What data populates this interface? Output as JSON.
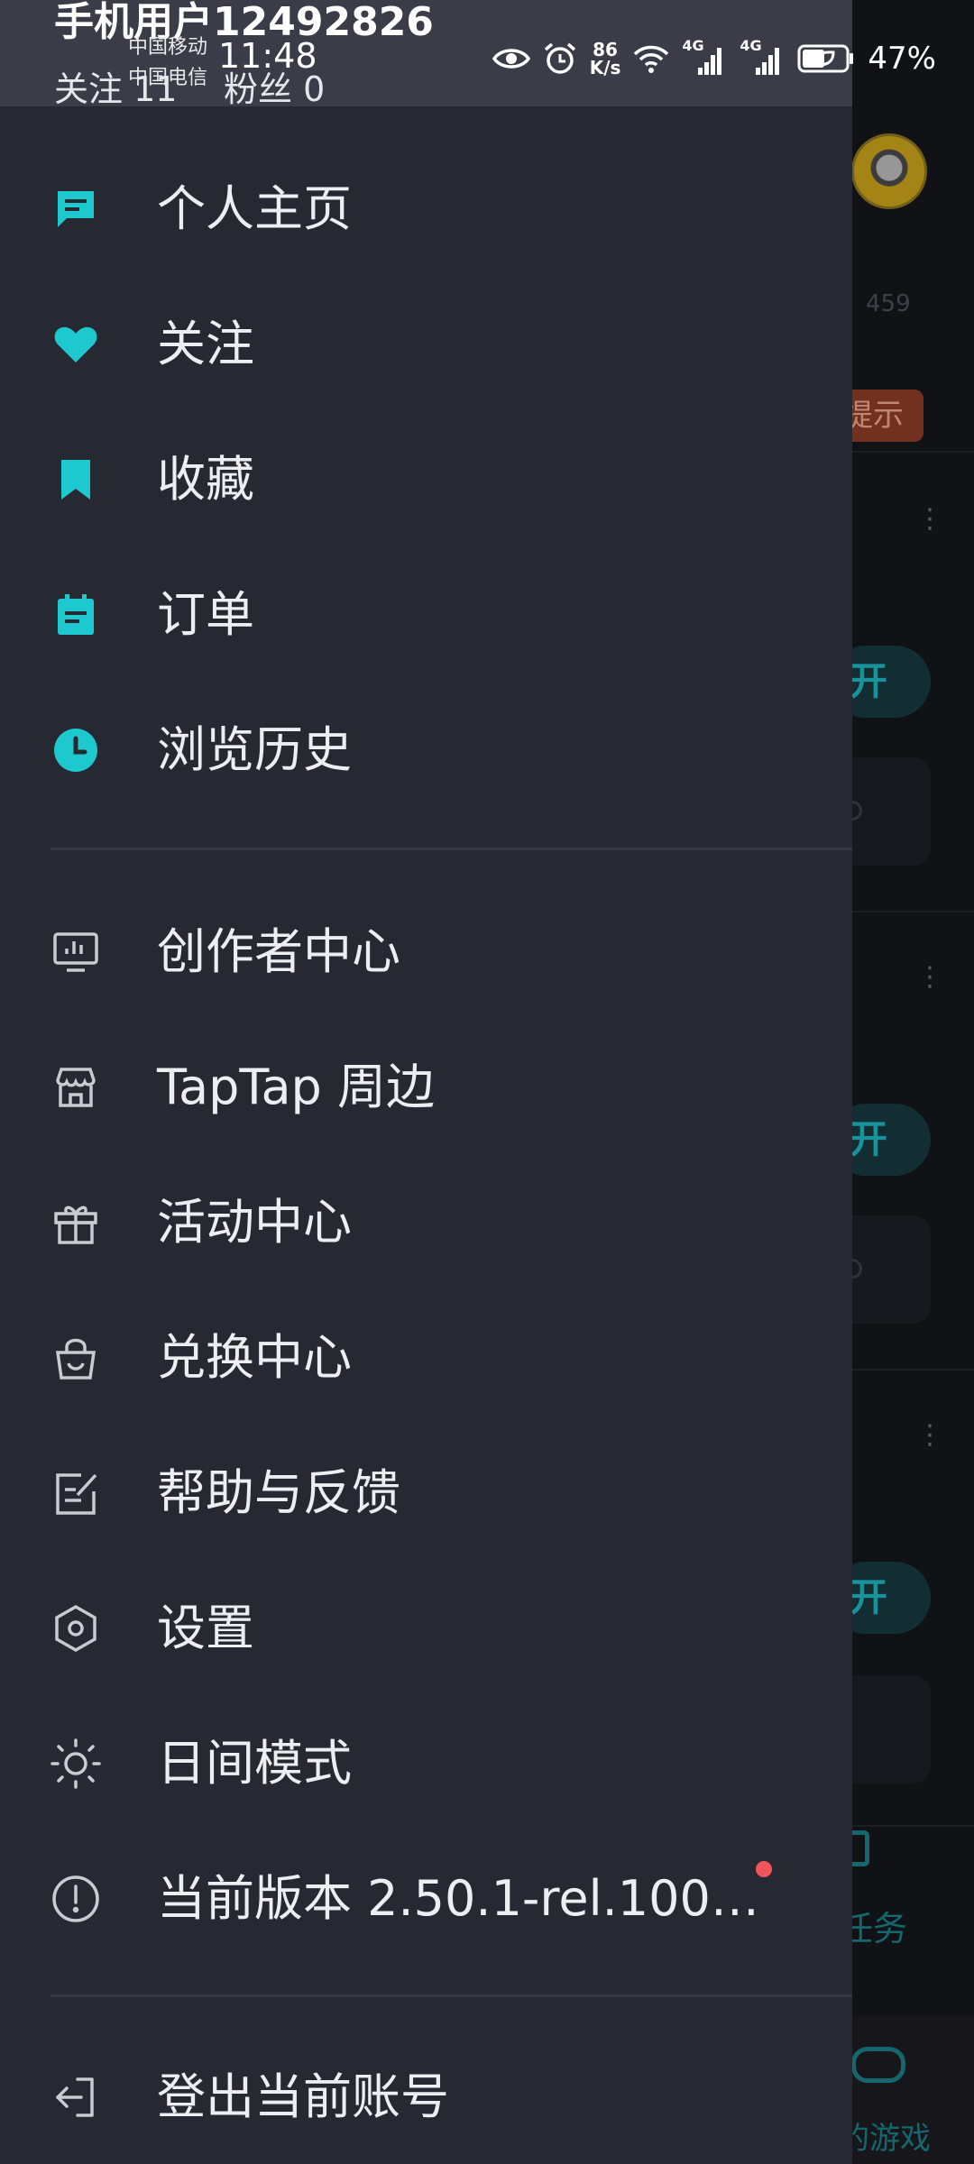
{
  "status_bar": {
    "carrier_1": "中国移动",
    "carrier_2": "中国电信",
    "time": "11:48",
    "net_speed_value": "86",
    "net_speed_unit": "K/s",
    "sim1_tech": "4G",
    "sim2_tech": "4G",
    "battery_percent": "47%"
  },
  "header": {
    "username": "手机用户12492826",
    "follow_text": "关注 11",
    "fans_text": "粉丝 0"
  },
  "menu_primary": [
    {
      "label": "个人主页",
      "icon": "profile-chat-icon"
    },
    {
      "label": "关注",
      "icon": "heart-icon"
    },
    {
      "label": "收藏",
      "icon": "bookmark-icon"
    },
    {
      "label": "订单",
      "icon": "order-clipboard-icon"
    },
    {
      "label": "浏览历史",
      "icon": "clock-icon"
    }
  ],
  "menu_secondary": [
    {
      "label": "创作者中心",
      "icon": "creator-monitor-icon"
    },
    {
      "label": "TapTap 周边",
      "icon": "store-icon"
    },
    {
      "label": "活动中心",
      "icon": "gift-icon"
    },
    {
      "label": "兑换中心",
      "icon": "shopping-bag-icon"
    },
    {
      "label": "帮助与反馈",
      "icon": "feedback-edit-icon"
    },
    {
      "label": "设置",
      "icon": "settings-hexagon-icon"
    },
    {
      "label": "日间模式",
      "icon": "sun-icon"
    },
    {
      "label": "当前版本 2.50.1-rel.100…",
      "icon": "info-circle-icon",
      "has_badge": true
    }
  ],
  "menu_footer": [
    {
      "label": "登出当前账号",
      "icon": "logout-icon"
    }
  ],
  "background_app": {
    "count_text": "459",
    "red_button_text": "提示",
    "pill_text": "开",
    "task_label": "任务",
    "game_label": "的游戏"
  },
  "colors": {
    "drawer_bg": "#272932",
    "header_bg": "#3a3d47",
    "accent_teal": "#1ec8cf",
    "icon_outline": "#c9cbd0",
    "badge_red": "#f2545b"
  }
}
